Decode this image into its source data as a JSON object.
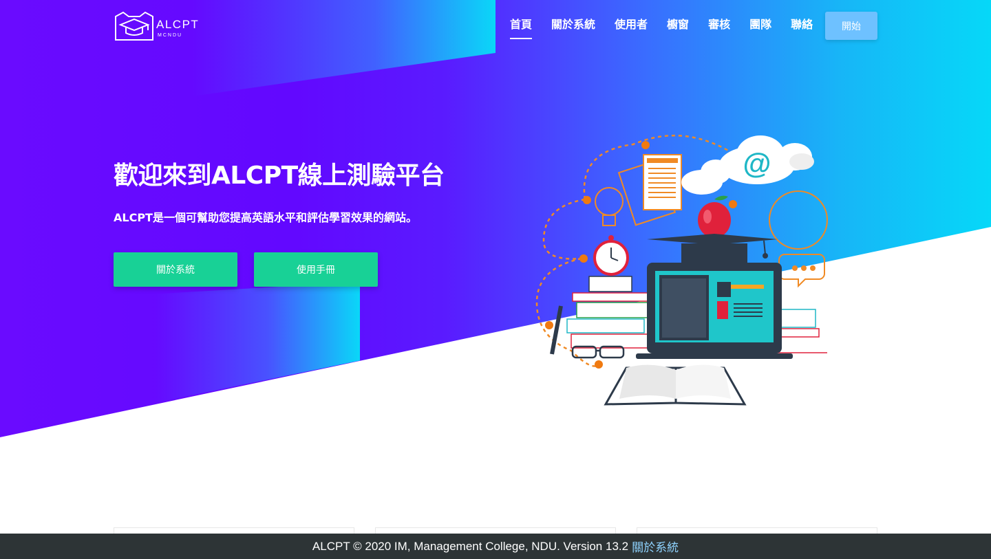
{
  "brand": {
    "logo_text": "ALCPT",
    "logo_sub": "MCNDU"
  },
  "nav": {
    "items": [
      {
        "label": "首頁",
        "active": true
      },
      {
        "label": "關於系統",
        "active": false
      },
      {
        "label": "使用者",
        "active": false
      },
      {
        "label": "櫥窗",
        "active": false
      },
      {
        "label": "審核",
        "active": false
      },
      {
        "label": "團隊",
        "active": false
      },
      {
        "label": "聯絡",
        "active": false
      }
    ],
    "start_label": "開始"
  },
  "hero": {
    "title": "歡迎來到ALCPT線上測驗平台",
    "subtitle": "ALCPT是一個可幫助您提高英語水平和評估學習效果的網站。",
    "buttons": {
      "about": "關於系統",
      "manual": "使用手冊"
    }
  },
  "illustration": {
    "email_symbol": "@"
  },
  "footer": {
    "text": "ALCPT © 2020 IM, Management College, NDU. Version 13.2",
    "link": "關於系統"
  },
  "colors": {
    "hero_gradient_start": "#6a0bff",
    "hero_gradient_end": "#06d8f8",
    "button_green": "#18d196",
    "start_button": "#6ec1ff",
    "footer_bg": "#2d3436",
    "footer_link": "#8fd3ff"
  }
}
